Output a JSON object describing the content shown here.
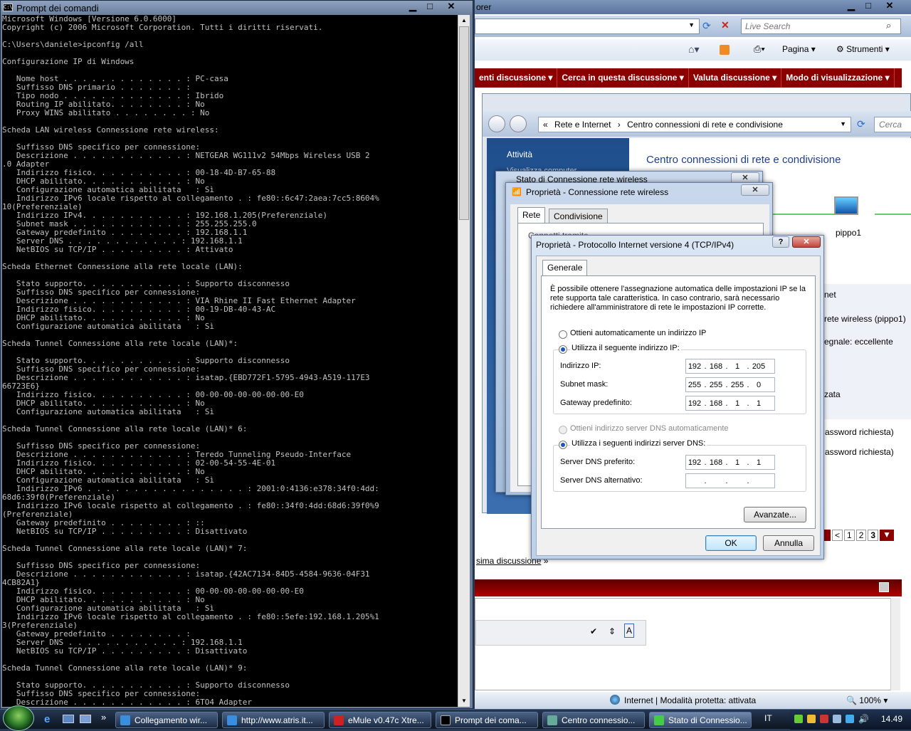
{
  "cmd": {
    "title": "Prompt dei comandi",
    "lines": "Microsoft Windows [Versione 6.0.6000]\nCopyright (c) 2006 Microsoft Corporation. Tutti i diritti riservati.\n\nC:\\Users\\daniele>ipconfig /all\n\nConfigurazione IP di Windows\n\n   Nome host . . . . . . . . . . . . . : PC-casa\n   Suffisso DNS primario . . . . . . . :\n   Tipo nodo . . . . . . . . . . . . . : Ibrido\n   Routing IP abilitato. . . . . . . . : No\n   Proxy WINS abilitato . . . . . . . . : No\n\nScheda LAN wireless Connessione rete wireless:\n\n   Suffisso DNS specifico per connessione:\n   Descrizione . . . . . . . . . . . . : NETGEAR WG111v2 54Mbps Wireless USB 2\n.0 Adapter\n   Indirizzo fisico. . . . . . . . . . : 00-18-4D-B7-65-88\n   DHCP abilitato. . . . . . . . . . . : No\n   Configurazione automatica abilitata   : Sì\n   Indirizzo IPv6 locale rispetto al collegamento . : fe80::6c47:2aea:7cc5:8604%\n10(Preferenziale)\n   Indirizzo IPv4. . . . . . . . . . . : 192.168.1.205(Preferenziale)\n   Subnet mask . . . . . . . . . . . . : 255.255.255.0\n   Gateway predefinito . . . . . . . . : 192.168.1.1\n   Server DNS . . . . . . . . . . . . : 192.168.1.1\n   NetBIOS su TCP/IP . . . . . . . . . : Attivato\n\nScheda Ethernet Connessione alla rete locale (LAN):\n\n   Stato supporto. . . . . . . . . . . : Supporto disconnesso\n   Suffisso DNS specifico per connessione:\n   Descrizione . . . . . . . . . . . . : VIA Rhine II Fast Ethernet Adapter\n   Indirizzo fisico. . . . . . . . . . : 00-19-DB-40-43-AC\n   DHCP abilitato. . . . . . . . . . . : No\n   Configurazione automatica abilitata   : Sì\n\nScheda Tunnel Connessione alla rete locale (LAN)*:\n\n   Stato supporto. . . . . . . . . . . : Supporto disconnesso\n   Suffisso DNS specifico per connessione:\n   Descrizione . . . . . . . . . . . . : isatap.{EBD772F1-5795-4943-A519-117E3\n66723E6}\n   Indirizzo fisico. . . . . . . . . . : 00-00-00-00-00-00-00-E0\n   DHCP abilitato. . . . . . . . . . . : No\n   Configurazione automatica abilitata   : Sì\n\nScheda Tunnel Connessione alla rete locale (LAN)* 6:\n\n   Suffisso DNS specifico per connessione:\n   Descrizione . . . . . . . . . . . . : Teredo Tunneling Pseudo-Interface\n   Indirizzo fisico. . . . . . . . . . : 02-00-54-55-4E-01\n   DHCP abilitato. . . . . . . . . . . : No\n   Configurazione automatica abilitata   : Sì\n   Indirizzo IPv6 . . . . . . . . . . . . . . . . . : 2001:0:4136:e378:34f0:4dd:\n68d6:39f0(Preferenziale)\n   Indirizzo IPv6 locale rispetto al collegamento . : fe80::34f0:4dd:68d6:39f0%9\n(Preferenziale)\n   Gateway predefinito . . . . . . . . : ::\n   NetBIOS su TCP/IP . . . . . . . . . : Disattivato\n\nScheda Tunnel Connessione alla rete locale (LAN)* 7:\n\n   Suffisso DNS specifico per connessione:\n   Descrizione . . . . . . . . . . . . : isatap.{42AC7134-84D5-4584-9636-04F31\n4CB82A1}\n   Indirizzo fisico. . . . . . . . . . : 00-00-00-00-00-00-00-E0\n   DHCP abilitato. . . . . . . . . . . : No\n   Configurazione automatica abilitata   : Sì\n   Indirizzo IPv6 locale rispetto al collegamento . : fe80::5efe:192.168.1.205%1\n3(Preferenziale)\n   Gateway predefinito . . . . . . . . :\n   Server DNS . . . . . . . . . . . . : 192.168.1.1\n   NetBIOS su TCP/IP . . . . . . . . . : Disattivato\n\nScheda Tunnel Connessione alla rete locale (LAN)* 9:\n\n   Stato supporto. . . . . . . . . . . : Supporto disconnesso\n   Suffisso DNS specifico per connessione:\n   Descrizione . . . . . . . . . . . . : 6TO4 Adapter"
  },
  "ie": {
    "title": "orer",
    "search_placeholder": "Live Search",
    "cmdbar": {
      "page": "Pagina",
      "tools": "Strumenti"
    },
    "redbar": [
      "enti discussione",
      "Cerca in questa discussione",
      "Valuta discussione",
      "Modo di visualizzazione"
    ],
    "status": "Internet | Modalità protetta: attivata",
    "zoom": "100%",
    "pager": [
      "<",
      "1",
      "2",
      "3"
    ],
    "next_link": "sima discussione",
    "next_arrow": "»"
  },
  "nc": {
    "breadcrumb": [
      "«",
      "Rete e Internet",
      "Centro connessioni di rete e condivisione"
    ],
    "search": "Cerca",
    "sidebar_title": "Attività",
    "sidebar_partial": "Visualizza computer",
    "heading": "Centro connessioni di rete e condivisione",
    "computer_name": "pippo1",
    "right_rows": [
      "net",
      "rete wireless (pippo1)",
      "egnale: eccellente",
      "zata",
      "assword richiesta)",
      "assword richiesta)"
    ]
  },
  "stato": {
    "title": "Stato di Connessione rete wireless"
  },
  "prop_wifi": {
    "title": "Proprietà - Connessione rete wireless",
    "tabs": [
      "Rete",
      "Condivisione"
    ],
    "partial_label": "Connetti tramite"
  },
  "tcp": {
    "title": "Proprietà - Protocollo Internet versione 4 (TCP/IPv4)",
    "help": "?",
    "close": "X",
    "tab": "Generale",
    "description": "È possibile ottenere l'assegnazione automatica delle impostazioni IP se la rete supporta tale caratteristica. In caso contrario, sarà necessario richiedere all'amministratore di rete le impostazioni IP corrette.",
    "opt_auto_ip": "Ottieni automaticamente un indirizzo IP",
    "opt_manual_ip": "Utilizza il seguente indirizzo IP:",
    "ip_label": "Indirizzo IP:",
    "ip": [
      "192",
      "168",
      "1",
      "205"
    ],
    "mask_label": "Subnet mask:",
    "mask": [
      "255",
      "255",
      "255",
      "0"
    ],
    "gw_label": "Gateway predefinito:",
    "gw": [
      "192",
      "168",
      "1",
      "1"
    ],
    "opt_auto_dns": "Ottieni indirizzo server DNS automaticamente",
    "opt_manual_dns": "Utilizza i seguenti indirizzi server DNS:",
    "dns1_label": "Server DNS preferito:",
    "dns1": [
      "192",
      "168",
      "1",
      "1"
    ],
    "dns2_label": "Server DNS alternativo:",
    "dns2": [
      "",
      "",
      "",
      ""
    ],
    "advanced": "Avanzate...",
    "ok": "OK",
    "cancel": "Annulla"
  },
  "taskbar": {
    "buttons": [
      "Collegamento wir...",
      "http://www.atris.it...",
      "eMule v0.47c Xtre...",
      "Prompt dei coma...",
      "Centro connessio...",
      "Stato di Connessio..."
    ],
    "lang": "IT",
    "clock": "14.49"
  },
  "colors": {
    "red_bar": "#8b0000",
    "heading_blue": "#1e3f8a",
    "console_bg": "#000000"
  }
}
